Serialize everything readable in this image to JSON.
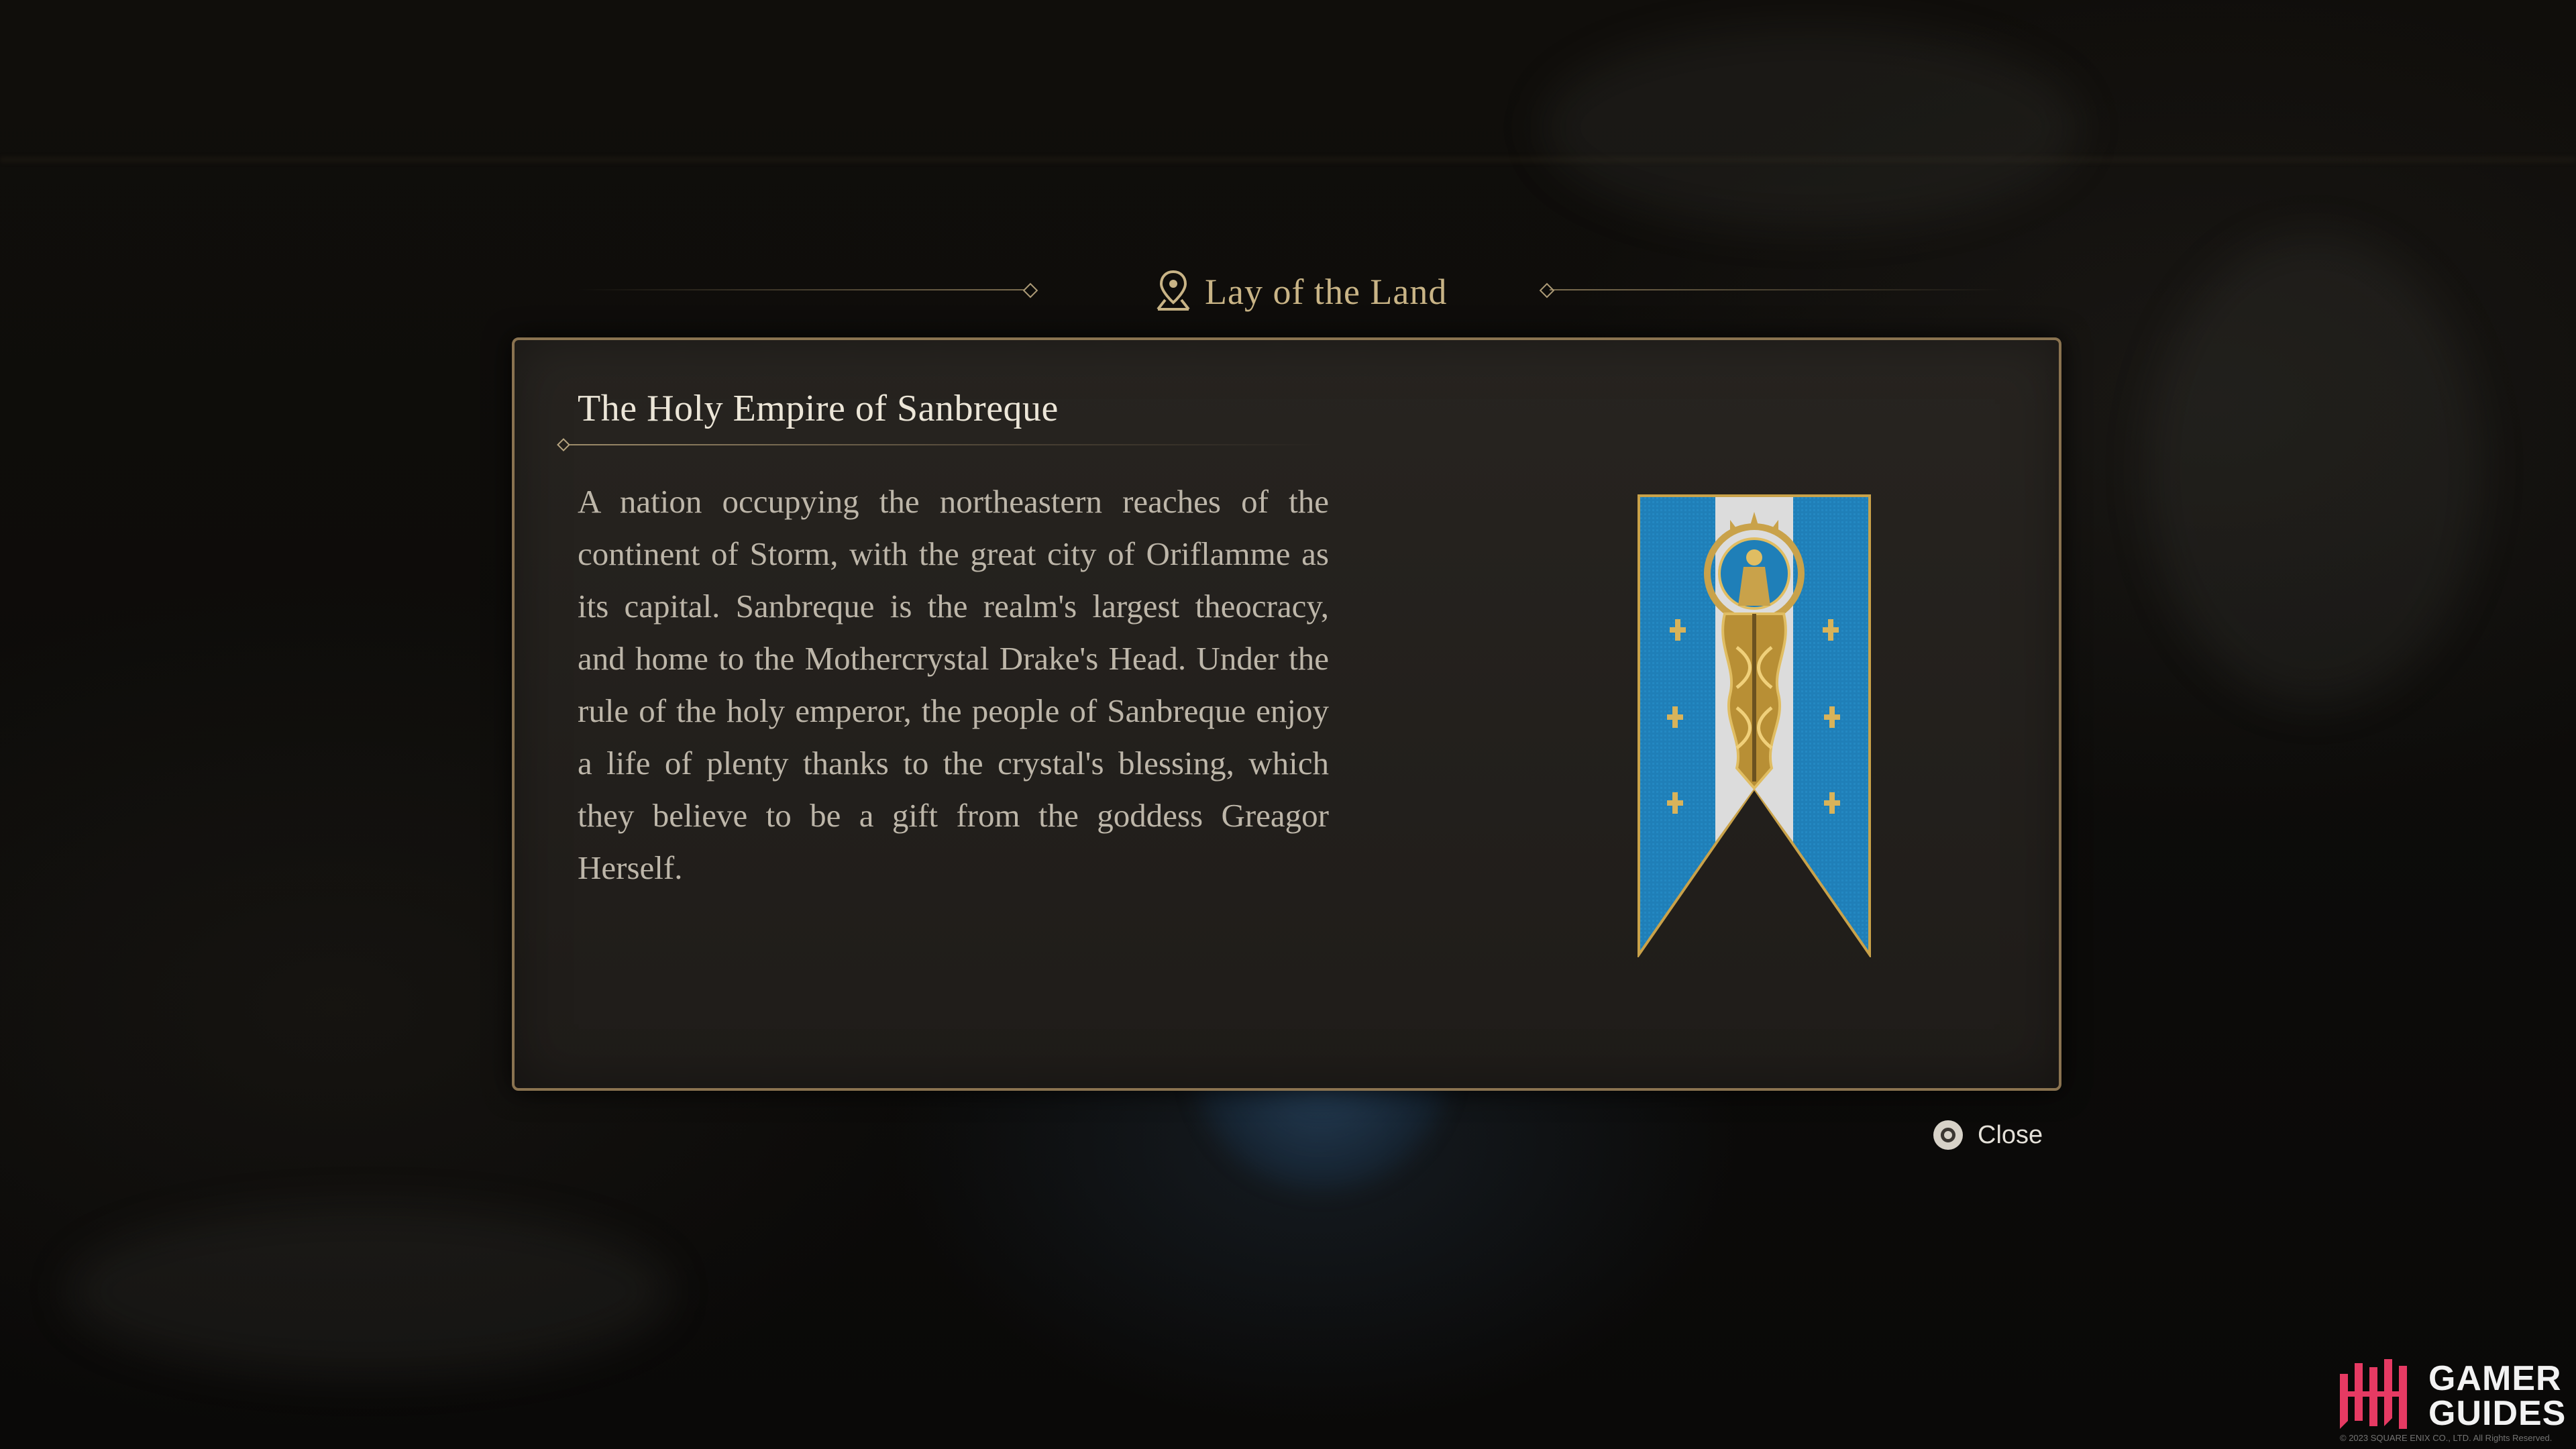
{
  "header": {
    "title": "Lay of the Land",
    "icon": "map-pin-icon"
  },
  "entry": {
    "title": "The Holy Empire of Sanbreque",
    "description": "A nation occupying the northeastern reaches of the continent of Storm, with the great city of Oriflamme as its capital. Sanbreque is the realm's largest theocracy, and home to the Mothercrystal Drake's Head. Under the rule of the holy emperor, the people of Sanbreque enjoy a life of plenty thanks to the crystal's blessing, which they believe to be a gift from the goddess Greagor Herself.",
    "image": "sanbreque-banner-emblem"
  },
  "controls": {
    "close_label": "Close",
    "close_icon": "circle-button-icon"
  },
  "watermark": {
    "logo_line1": "GAMER",
    "logo_line2": "GUIDES",
    "copyright": "© 2023 SQUARE ENIX CO., LTD. All Rights Reserved."
  },
  "colors": {
    "accent_gold": "#c9b486",
    "panel_border": "#8a7350",
    "banner_blue": "#1f7fb8",
    "banner_gold": "#c9a24a"
  }
}
